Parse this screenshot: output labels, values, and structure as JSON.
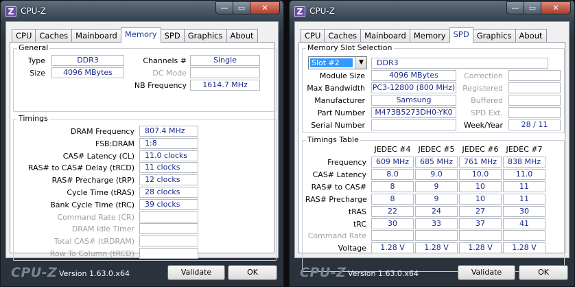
{
  "common": {
    "app_icon": "Z",
    "title": "CPU-Z",
    "controls": {
      "minimize": "—",
      "maximize": "▭",
      "close": "✕"
    },
    "tabs": [
      "CPU",
      "Caches",
      "Mainboard",
      "Memory",
      "SPD",
      "Graphics",
      "About"
    ],
    "logo": "CPU-Z",
    "version": "Version 1.63.0.x64",
    "validate_label": "Validate",
    "ok_label": "OK"
  },
  "memory": {
    "active_tab": "Memory",
    "general": {
      "label": "General",
      "type_label": "Type",
      "type": "DDR3",
      "size_label": "Size",
      "size": "4096 MBytes",
      "channels_label": "Channels #",
      "channels": "Single",
      "dc_mode_label": "DC Mode",
      "dc_mode": "",
      "nb_freq_label": "NB Frequency",
      "nb_freq": "1614.7 MHz"
    },
    "timings": {
      "label": "Timings",
      "rows": [
        {
          "label": "DRAM Frequency",
          "value": "807.4 MHz",
          "enabled": true
        },
        {
          "label": "FSB:DRAM",
          "value": "1:8",
          "enabled": true
        },
        {
          "label": "CAS# Latency (CL)",
          "value": "11.0 clocks",
          "enabled": true
        },
        {
          "label": "RAS# to CAS# Delay (tRCD)",
          "value": "11 clocks",
          "enabled": true
        },
        {
          "label": "RAS# Precharge (tRP)",
          "value": "12 clocks",
          "enabled": true
        },
        {
          "label": "Cycle Time (tRAS)",
          "value": "28 clocks",
          "enabled": true
        },
        {
          "label": "Bank Cycle Time (tRC)",
          "value": "39 clocks",
          "enabled": true
        },
        {
          "label": "Command Rate (CR)",
          "value": "",
          "enabled": false
        },
        {
          "label": "DRAM Idle Timer",
          "value": "",
          "enabled": false
        },
        {
          "label": "Total CAS# (tRDRAM)",
          "value": "",
          "enabled": false
        },
        {
          "label": "Row To Column (tRCD)",
          "value": "",
          "enabled": false
        }
      ]
    }
  },
  "spd": {
    "active_tab": "SPD",
    "slot": {
      "label": "Memory Slot Selection",
      "selected": "Slot #2",
      "type": "DDR3",
      "module_size_label": "Module Size",
      "module_size": "4096 MBytes",
      "max_bw_label": "Max Bandwidth",
      "max_bw": "PC3-12800 (800 MHz)",
      "manufacturer_label": "Manufacturer",
      "manufacturer": "Samsung",
      "part_label": "Part Number",
      "part": "M473B5273DH0-YK0",
      "serial_label": "Serial Number",
      "serial": "",
      "correction_label": "Correction",
      "correction": "",
      "registered_label": "Registered",
      "registered": "",
      "buffered_label": "Buffered",
      "buffered": "",
      "spd_ext_label": "SPD Ext.",
      "spd_ext": "",
      "week_year_label": "Week/Year",
      "week_year": "28 / 11"
    },
    "timings_table": {
      "label": "Timings Table",
      "columns": [
        "JEDEC #4",
        "JEDEC #5",
        "JEDEC #6",
        "JEDEC #7"
      ],
      "rows": [
        {
          "label": "Frequency",
          "values": [
            "609 MHz",
            "685 MHz",
            "761 MHz",
            "838 MHz"
          ],
          "enabled": true
        },
        {
          "label": "CAS# Latency",
          "values": [
            "8.0",
            "9.0",
            "10.0",
            "11.0"
          ],
          "enabled": true
        },
        {
          "label": "RAS# to CAS#",
          "values": [
            "8",
            "9",
            "10",
            "11"
          ],
          "enabled": true
        },
        {
          "label": "RAS# Precharge",
          "values": [
            "8",
            "9",
            "10",
            "11"
          ],
          "enabled": true
        },
        {
          "label": "tRAS",
          "values": [
            "22",
            "24",
            "27",
            "30"
          ],
          "enabled": true
        },
        {
          "label": "tRC",
          "values": [
            "30",
            "33",
            "37",
            "41"
          ],
          "enabled": true
        },
        {
          "label": "Command Rate",
          "values": [
            "",
            "",
            "",
            ""
          ],
          "enabled": false
        },
        {
          "label": "Voltage",
          "values": [
            "1.28 V",
            "1.28 V",
            "1.28 V",
            "1.28 V"
          ],
          "enabled": true
        }
      ]
    }
  }
}
